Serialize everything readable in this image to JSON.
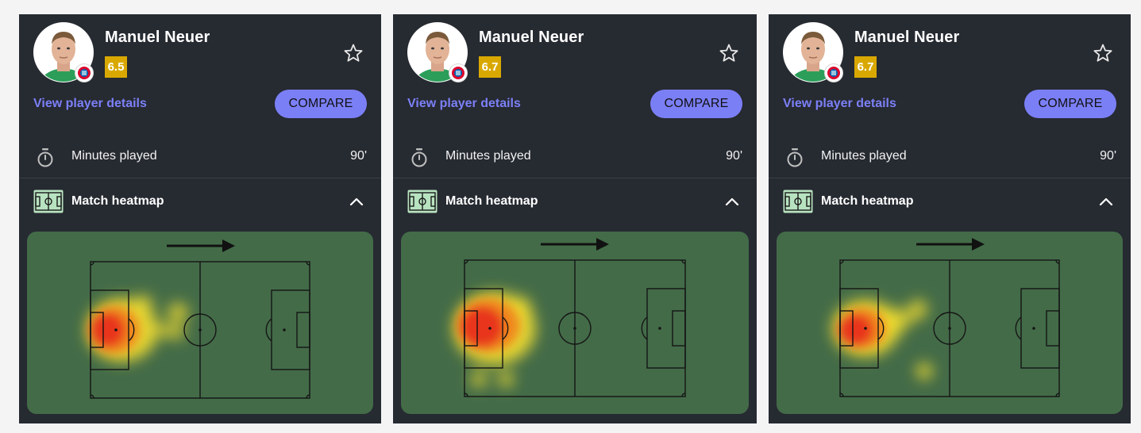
{
  "colors": {
    "card_bg": "#262a31",
    "accent": "#7b7ff6",
    "link": "#7c80f7",
    "rating_badge": "#d9a800",
    "pitch": "#436b48",
    "page_bg": "#f4f4f5"
  },
  "icons": {
    "favorite": "star-outline-icon",
    "minutes": "stopwatch-icon",
    "heatmap": "pitch-icon",
    "collapse": "chevron-up-icon",
    "direction": "attack-direction-arrow-icon",
    "club": "club-crest-icon"
  },
  "cards": [
    {
      "player_name": "Manuel Neuer",
      "rating": "6.5",
      "details_link": "View player details",
      "compare_label": "COMPARE",
      "stat_label": "Minutes played",
      "stat_value": "90'",
      "section_title": "Match heatmap"
    },
    {
      "player_name": "Manuel Neuer",
      "rating": "6.7",
      "details_link": "View player details",
      "compare_label": "COMPARE",
      "stat_label": "Minutes played",
      "stat_value": "90'",
      "section_title": "Match heatmap"
    },
    {
      "player_name": "Manuel Neuer",
      "rating": "6.7",
      "details_link": "View player details",
      "compare_label": "COMPARE",
      "stat_label": "Minutes played",
      "stat_value": "90'",
      "section_title": "Match heatmap"
    }
  ]
}
